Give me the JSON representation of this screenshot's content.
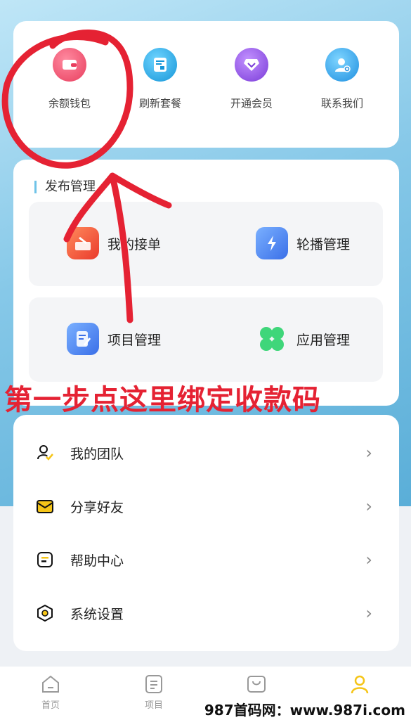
{
  "quick_actions": [
    {
      "label": "余额钱包",
      "icon": "wallet-icon",
      "color": "#ef4f6b"
    },
    {
      "label": "刷新套餐",
      "icon": "refresh-plan-icon",
      "color": "#1ea5e2"
    },
    {
      "label": "开通会员",
      "icon": "vip-diamond-icon",
      "color": "#8a4ce0"
    },
    {
      "label": "联系我们",
      "icon": "contact-icon",
      "color": "#2aa4ea"
    }
  ],
  "publish": {
    "title": "发布管理",
    "items": [
      {
        "label": "我的接单",
        "icon": "orders-icon",
        "color": "#f1573a"
      },
      {
        "label": "轮播管理",
        "icon": "carousel-icon",
        "color": "#4a86f0"
      },
      {
        "label": "项目管理",
        "icon": "project-icon",
        "color": "#4a86f0"
      },
      {
        "label": "应用管理",
        "icon": "apps-icon",
        "color": "#3fd67a"
      }
    ]
  },
  "menu": [
    {
      "label": "我的团队",
      "icon": "team-icon"
    },
    {
      "label": "分享好友",
      "icon": "share-icon"
    },
    {
      "label": "帮助中心",
      "icon": "help-icon"
    },
    {
      "label": "系统设置",
      "icon": "settings-icon"
    }
  ],
  "tabs": [
    {
      "label": "首页",
      "icon": "home-icon"
    },
    {
      "label": "项目",
      "icon": "project-tab-icon"
    },
    {
      "label": "",
      "icon": "bag-icon"
    },
    {
      "label": "",
      "icon": "profile-icon",
      "active": true
    }
  ],
  "annotation": {
    "text": "第一步点这里绑定收款码",
    "color": "#e52233"
  },
  "watermark": "987首码网：www.987i.com",
  "colors": {
    "accent": "#f5c518",
    "annotation_red": "#e52233"
  }
}
